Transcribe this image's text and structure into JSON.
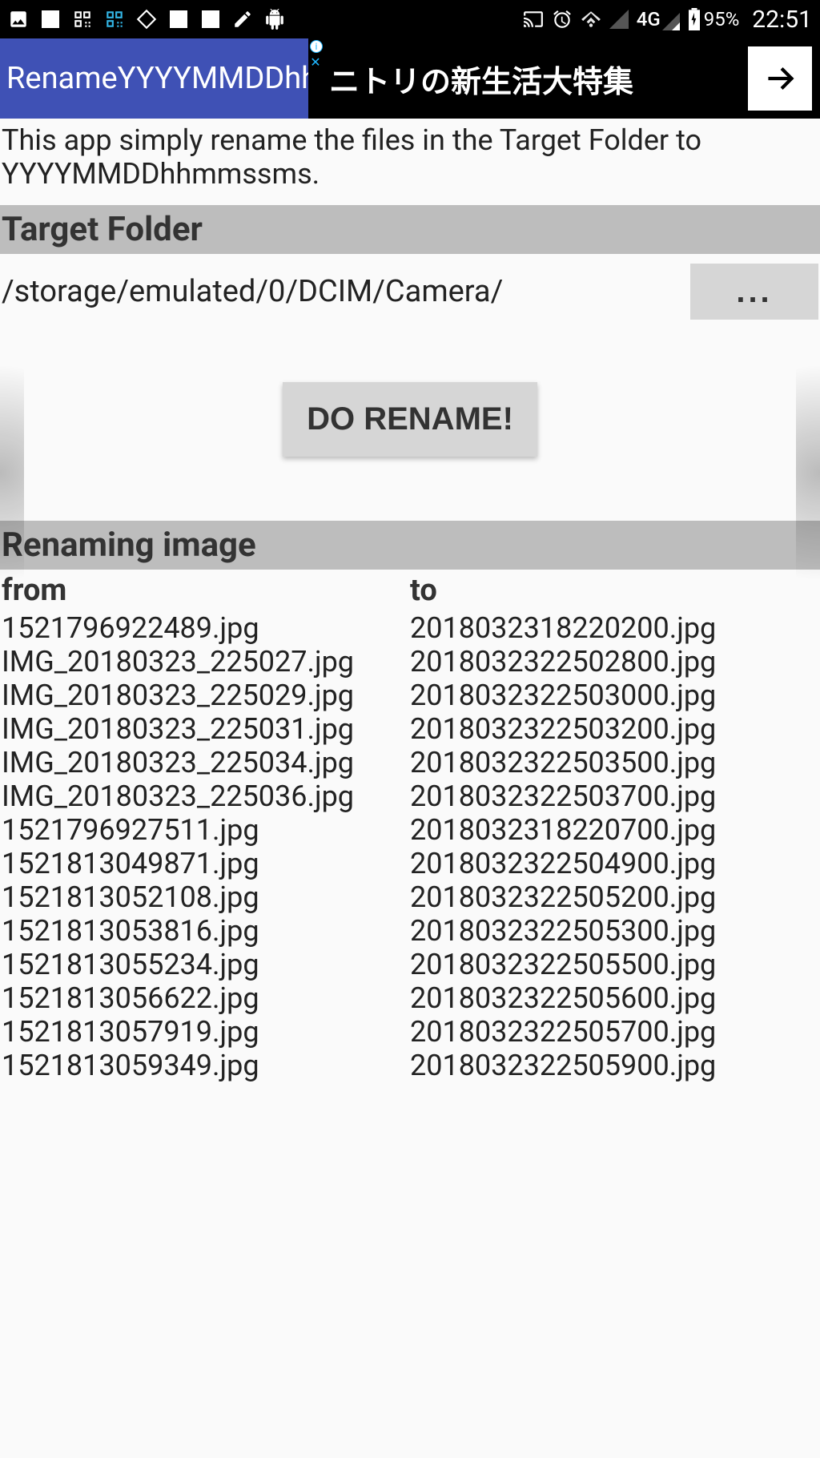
{
  "status_bar": {
    "battery_pct": "95%",
    "clock": "22:51",
    "network": "4G"
  },
  "app": {
    "title": "RenameYYYYMMDDhhmmssms"
  },
  "ad": {
    "text": "ニトリの新生活大特集"
  },
  "description": "This app simply rename the files in the Target Folder to YYYYMMDDhhmmssms.",
  "sections": {
    "target_folder_label": "Target Folder",
    "renaming_image_label": "Renaming image"
  },
  "target_folder": {
    "path": "/storage/emulated/0/DCIM/Camera/",
    "browse_label": "..."
  },
  "action": {
    "do_rename_label": "DO RENAME!"
  },
  "columns": {
    "from_label": "from",
    "to_label": "to"
  },
  "files": {
    "from": [
      "1521796922489.jpg",
      "IMG_20180323_225027.jpg",
      "IMG_20180323_225029.jpg",
      "IMG_20180323_225031.jpg",
      "IMG_20180323_225034.jpg",
      "IMG_20180323_225036.jpg",
      "1521796927511.jpg",
      "1521813049871.jpg",
      "1521813052108.jpg",
      "1521813053816.jpg",
      "1521813055234.jpg",
      "1521813056622.jpg",
      "1521813057919.jpg",
      "1521813059349.jpg"
    ],
    "to": [
      "2018032318220200.jpg",
      "2018032322502800.jpg",
      "2018032322503000.jpg",
      "2018032322503200.jpg",
      "2018032322503500.jpg",
      "2018032322503700.jpg",
      "2018032318220700.jpg",
      "2018032322504900.jpg",
      "2018032322505200.jpg",
      "2018032322505300.jpg",
      "2018032322505500.jpg",
      "2018032322505600.jpg",
      "2018032322505700.jpg",
      "2018032322505900.jpg"
    ]
  }
}
